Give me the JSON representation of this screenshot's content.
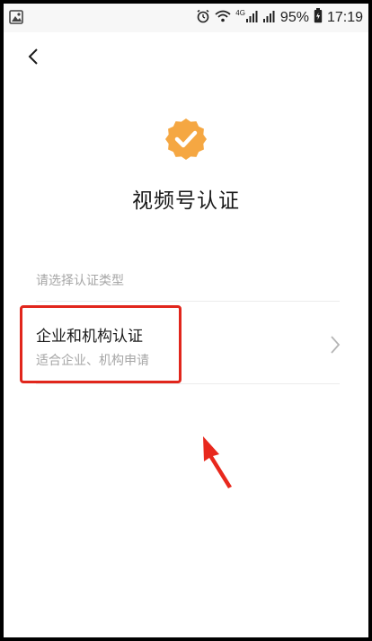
{
  "status_bar": {
    "signal_tag": "4G",
    "battery": "95%",
    "time": "17:19"
  },
  "page": {
    "title": "视频号认证",
    "section_label": "请选择认证类型"
  },
  "option": {
    "title": "企业和机构认证",
    "subtitle": "适合企业、机构申请"
  },
  "colors": {
    "badge": "#f5a742",
    "highlight": "#e1261c",
    "arrow": "#e8281d"
  },
  "icons": [
    "image-icon",
    "alarm-icon",
    "wifi-icon",
    "signal-icon",
    "battery-icon",
    "back-icon",
    "verified-badge-icon",
    "chevron-right-icon",
    "arrow-annotation"
  ]
}
